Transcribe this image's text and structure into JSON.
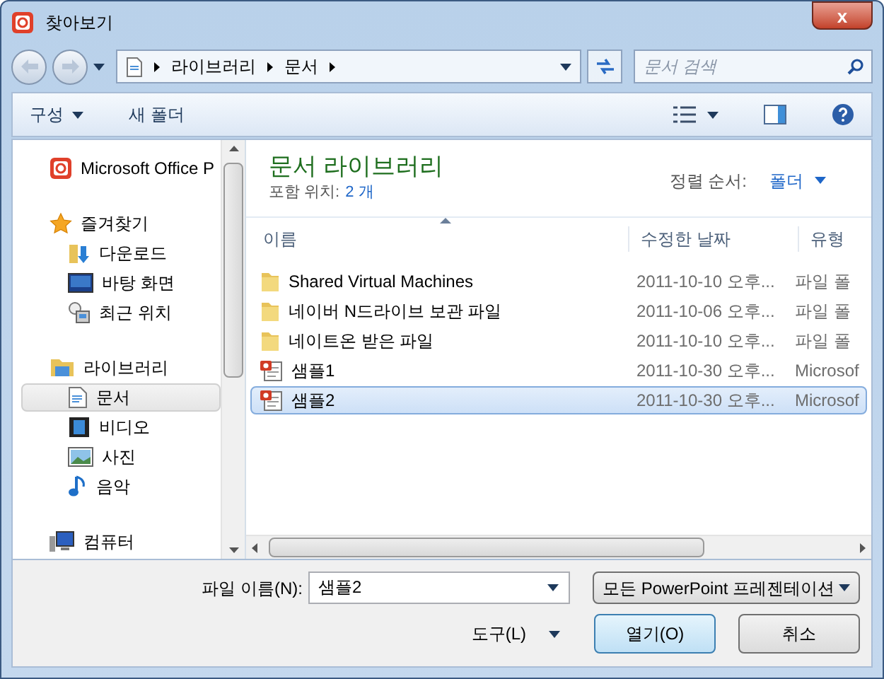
{
  "window": {
    "title": "찾아보기",
    "close": "x"
  },
  "address": {
    "crumbs": [
      "라이브러리",
      "문서"
    ],
    "search_placeholder": "문서 검색"
  },
  "toolbar": {
    "organize": "구성",
    "new_folder": "새 폴더"
  },
  "sidebar": {
    "app": "Microsoft Office P",
    "groups": [
      {
        "label": "즐겨찾기",
        "children": [
          {
            "label": "다운로드",
            "selected": false
          },
          {
            "label": "바탕 화면",
            "selected": false
          },
          {
            "label": "최근 위치",
            "selected": false
          }
        ]
      },
      {
        "label": "라이브러리",
        "children": [
          {
            "label": "문서",
            "selected": true
          },
          {
            "label": "비디오",
            "selected": false
          },
          {
            "label": "사진",
            "selected": false
          },
          {
            "label": "음악",
            "selected": false
          }
        ]
      },
      {
        "label": "컴퓨터"
      }
    ]
  },
  "library": {
    "title": "문서 라이브러리",
    "includes_label": "포함 위치:",
    "includes_value": "2 개",
    "sort_label": "정렬 순서:",
    "sort_value": "폴더"
  },
  "table": {
    "columns": [
      "이름",
      "수정한 날짜",
      "유형"
    ],
    "rows": [
      {
        "kind": "folder",
        "name": "Shared Virtual Machines",
        "date": "2011-10-10 오후...",
        "type": "파일 폴",
        "selected": false
      },
      {
        "kind": "folder",
        "name": "네이버 N드라이브 보관 파일",
        "date": "2011-10-06 오후...",
        "type": "파일 폴",
        "selected": false
      },
      {
        "kind": "folder",
        "name": "네이트온 받은 파일",
        "date": "2011-10-10 오후...",
        "type": "파일 폴",
        "selected": false
      },
      {
        "kind": "ppt",
        "name": "샘플1",
        "date": "2011-10-30 오후...",
        "type": "Microsof",
        "selected": false
      },
      {
        "kind": "ppt",
        "name": "샘플2",
        "date": "2011-10-30 오후...",
        "type": "Microsof",
        "selected": true
      }
    ]
  },
  "bottom": {
    "filename_label": "파일 이름(N):",
    "filename_value": "샘플2",
    "filter": "모든 PowerPoint 프레젠테이션",
    "tools": "도구(L)",
    "open": "열기(O)",
    "cancel": "취소"
  }
}
